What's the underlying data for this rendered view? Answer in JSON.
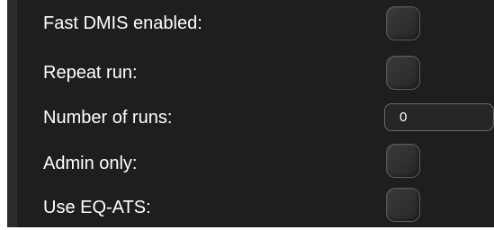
{
  "settings": {
    "fast_dmis": {
      "label": "Fast DMIS enabled:",
      "checked": false
    },
    "repeat_run": {
      "label": "Repeat run:",
      "checked": false
    },
    "number_of_runs": {
      "label": "Number of runs:",
      "value": "0"
    },
    "admin_only": {
      "label": "Admin only:",
      "checked": false
    },
    "use_eq_ats": {
      "label": "Use EQ-ATS:",
      "checked": false
    }
  },
  "colors": {
    "panel_background": "#1e1e1e",
    "text": "#ffffff",
    "control_background": "#303030",
    "control_border": "#5a5a5a"
  }
}
